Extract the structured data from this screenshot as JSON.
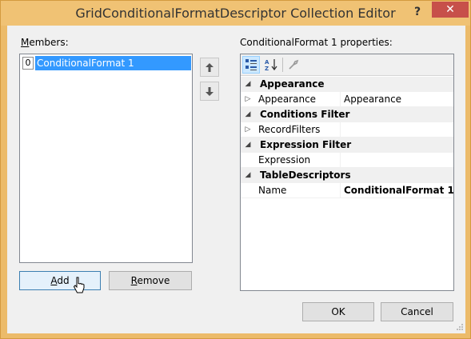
{
  "window": {
    "title": "GridConditionalFormatDescriptor Collection Editor",
    "help_label": "?",
    "close_label": "✕"
  },
  "members": {
    "label": "Members:",
    "items": [
      {
        "index": "0",
        "name": "ConditionalFormat 1",
        "selected": true
      }
    ]
  },
  "properties": {
    "label": "ConditionalFormat 1 properties:",
    "toolbar": [
      "categorized-icon",
      "alphabetical-icon",
      "property-pages-icon"
    ],
    "rows": [
      {
        "type": "category",
        "name": "Appearance"
      },
      {
        "type": "property",
        "name": "Appearance",
        "value": "Appearance",
        "expandable": true
      },
      {
        "type": "category",
        "name": "Conditions Filter"
      },
      {
        "type": "property",
        "name": "RecordFilters",
        "value": "",
        "expandable": true
      },
      {
        "type": "category",
        "name": "Expression Filter"
      },
      {
        "type": "property",
        "name": "Expression",
        "value": "",
        "expandable": false
      },
      {
        "type": "category",
        "name": "TableDescriptors"
      },
      {
        "type": "property",
        "name": "Name",
        "value": "ConditionalFormat 1",
        "expandable": false,
        "bold_value": true
      }
    ]
  },
  "buttons": {
    "add": "Add",
    "remove": "Remove",
    "ok": "OK",
    "cancel": "Cancel"
  },
  "colors": {
    "titlebar": "#f0c274",
    "close": "#c7504a",
    "selection": "#3399ff"
  }
}
